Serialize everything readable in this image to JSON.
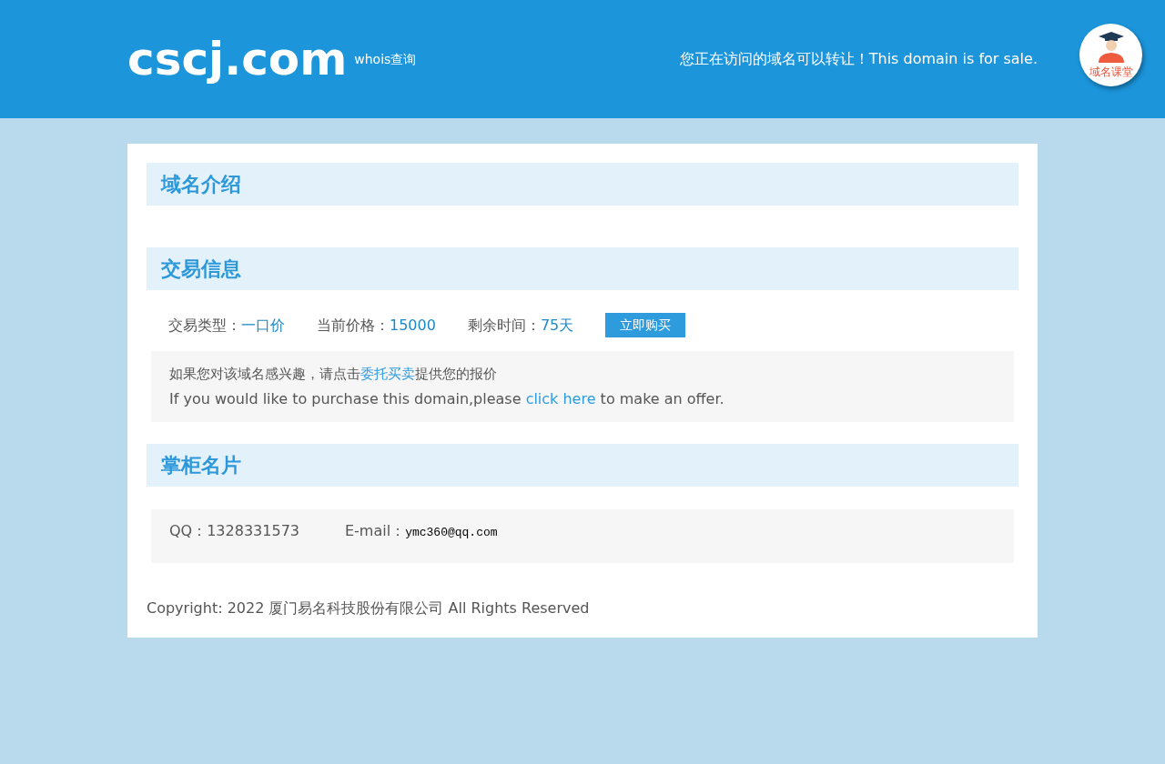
{
  "header": {
    "logo": "cscj.com",
    "whois_link": "whois查询",
    "notice": "您正在访问的域名可以转让！This domain is for sale.",
    "badge_label": "域名课堂"
  },
  "intro": {
    "title": "域名介绍"
  },
  "trade": {
    "title": "交易信息",
    "fields": [
      {
        "label": "交易类型：",
        "value": "一口价"
      },
      {
        "label": "当前价格：",
        "value": "15000"
      },
      {
        "label": "剩余时间：",
        "value": "75天"
      }
    ],
    "buy_button": "立即购买",
    "offer_lines": [
      {
        "before": "如果您对该域名感兴趣，请点击",
        "link": "委托买卖",
        "after": "提供您的报价"
      },
      {
        "before": "If you would like to purchase this domain,please ",
        "link": "click here",
        "after": " to make an offer."
      }
    ]
  },
  "contact": {
    "title": "掌柜名片",
    "items": [
      {
        "label": "QQ：",
        "value": "1328331573",
        "kind": "text"
      },
      {
        "label": "E-mail：",
        "value": "ymc360@qq.com",
        "kind": "mono"
      }
    ]
  },
  "copyright": "Copyright: 2022 厦门易名科技股份有限公司 All Rights Reserved"
}
